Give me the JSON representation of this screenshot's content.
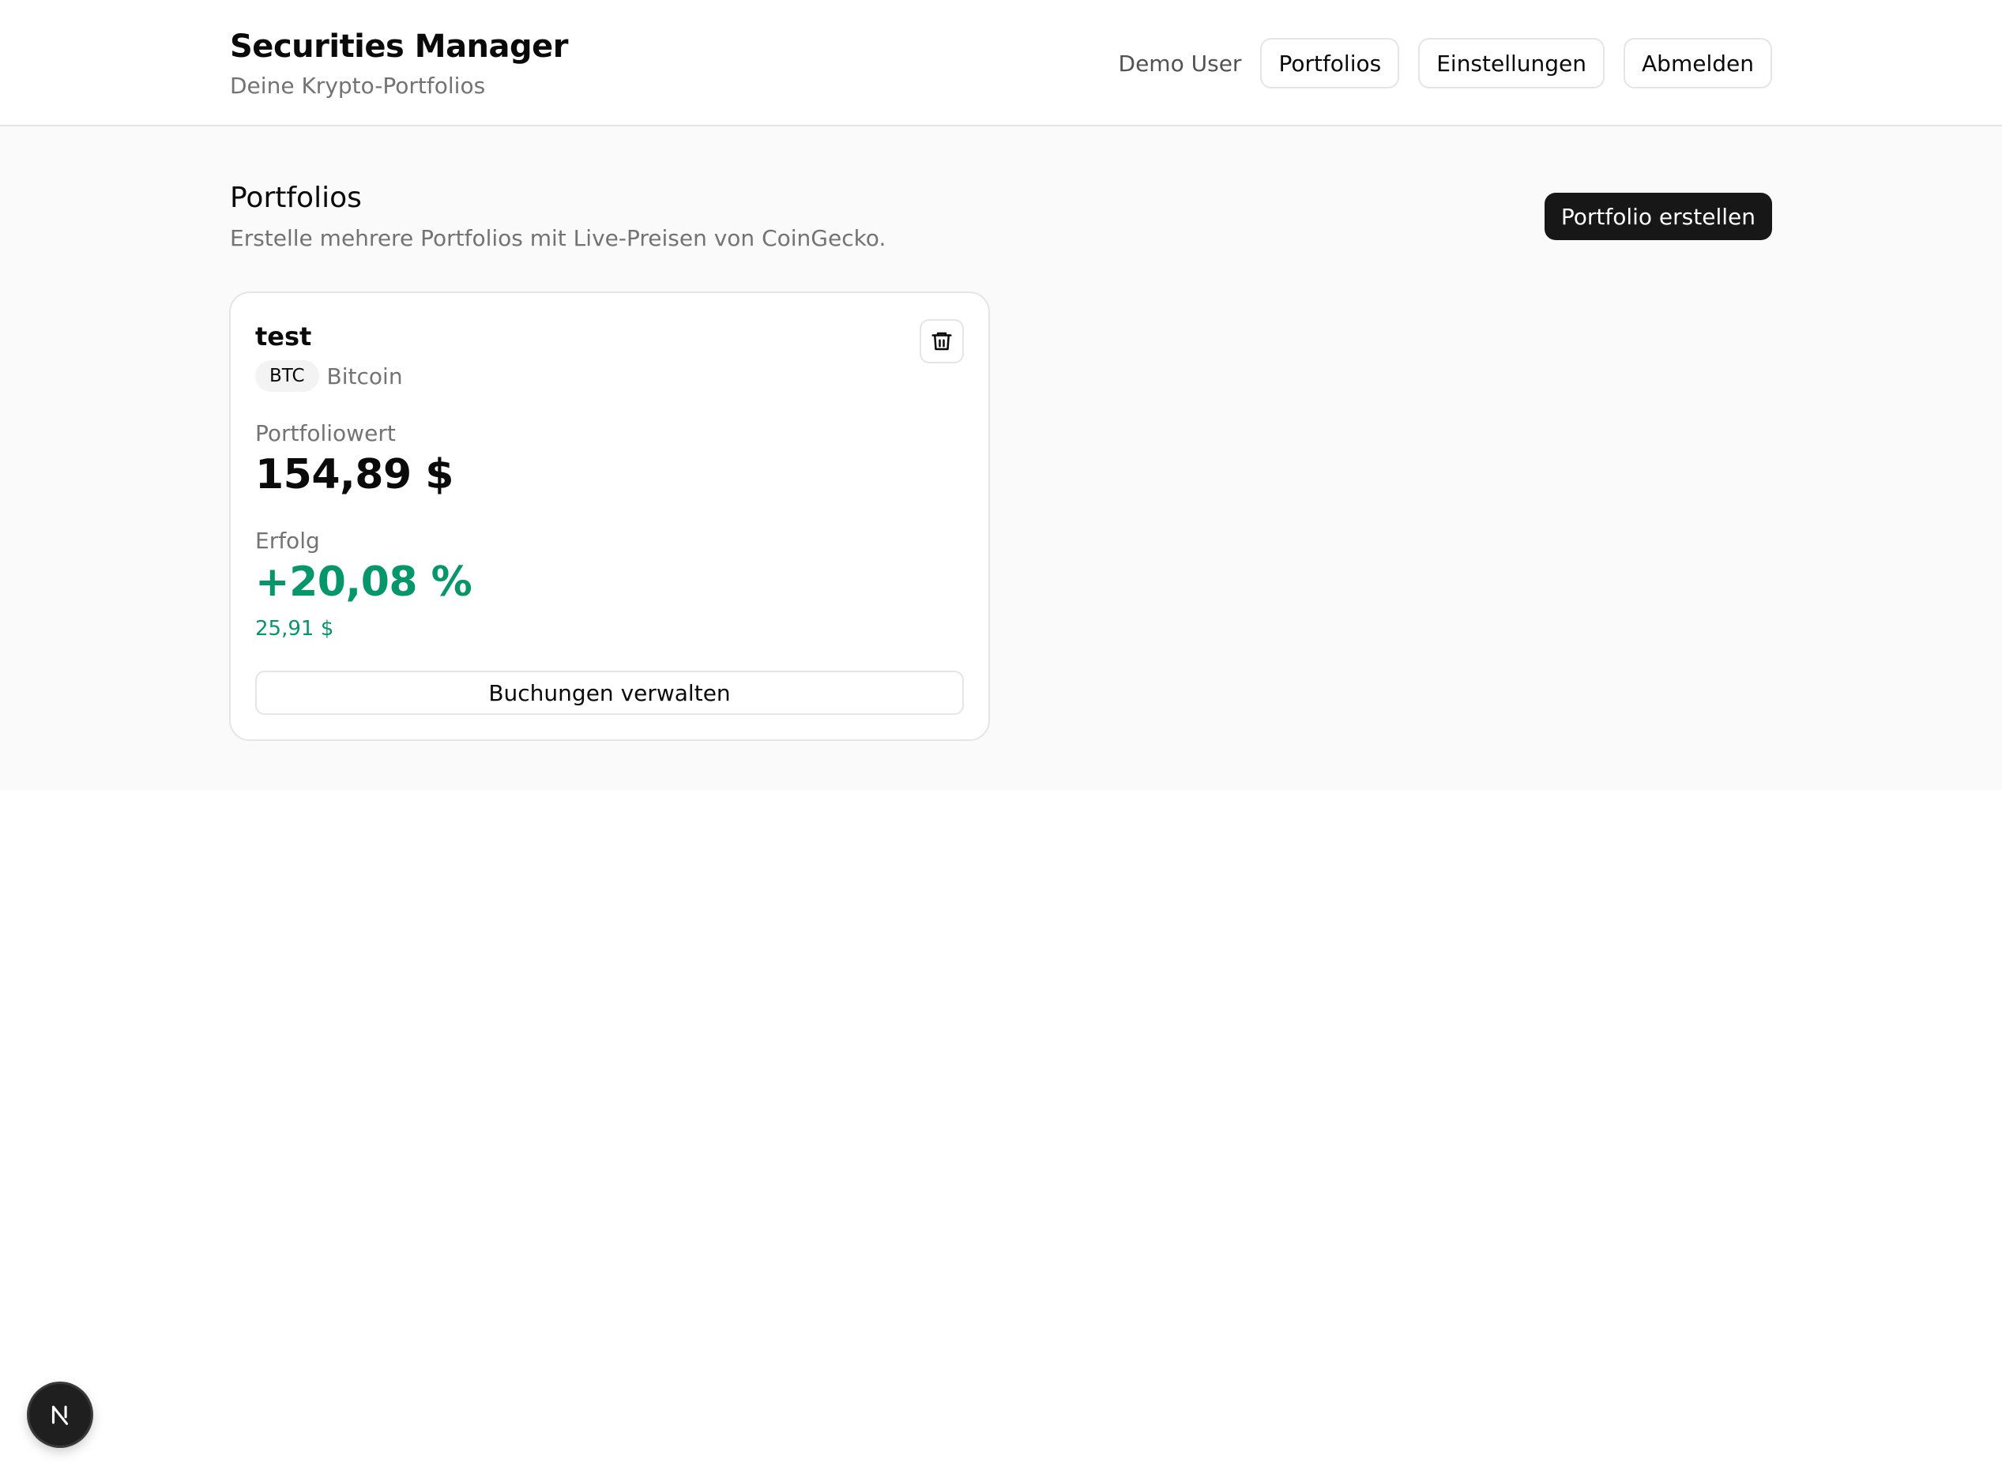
{
  "header": {
    "title": "Securities Manager",
    "subtitle": "Deine Krypto-Portfolios",
    "user_name": "Demo User",
    "nav": {
      "portfolios_label": "Portfolios",
      "settings_label": "Einstellungen",
      "logout_label": "Abmelden"
    }
  },
  "main": {
    "title": "Portfolios",
    "subtitle": "Erstelle mehrere Portfolios mit Live-Preisen von CoinGecko.",
    "create_button_label": "Portfolio erstellen",
    "portfolios": [
      {
        "name": "test",
        "symbol": "BTC",
        "asset_name": "Bitcoin",
        "value_label": "Portfoliowert",
        "value": "154,89 $",
        "performance_label": "Erfolg",
        "performance_percent": "+20,08 %",
        "performance_absolute": "25,91 $",
        "bookings_button_label": "Buchungen verwalten",
        "delete_icon": "trash-icon"
      }
    ]
  },
  "devtools": {
    "icon": "next-logo-icon"
  },
  "colors": {
    "accent_dark": "#171717",
    "positive": "#059669",
    "muted_text": "#737373",
    "border": "#e5e5e5",
    "page_background": "#fafafa"
  }
}
